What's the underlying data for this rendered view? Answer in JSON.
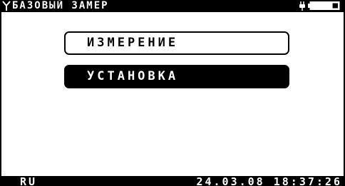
{
  "header": {
    "title": "БАЗОВЫЙ ЗАМЕР",
    "icons": [
      "antenna-icon",
      "plug-icon",
      "battery-icon"
    ],
    "battery_level": 0.2
  },
  "menu": {
    "items": [
      {
        "label": "ИЗМЕРЕНИЕ",
        "selected": false
      },
      {
        "label": "УСТАНОВКА",
        "selected": true
      }
    ]
  },
  "status": {
    "language": "RU",
    "datetime": "24.03.08 18:37:26"
  },
  "colors": {
    "foreground": "#000000",
    "background": "#ffffff"
  }
}
